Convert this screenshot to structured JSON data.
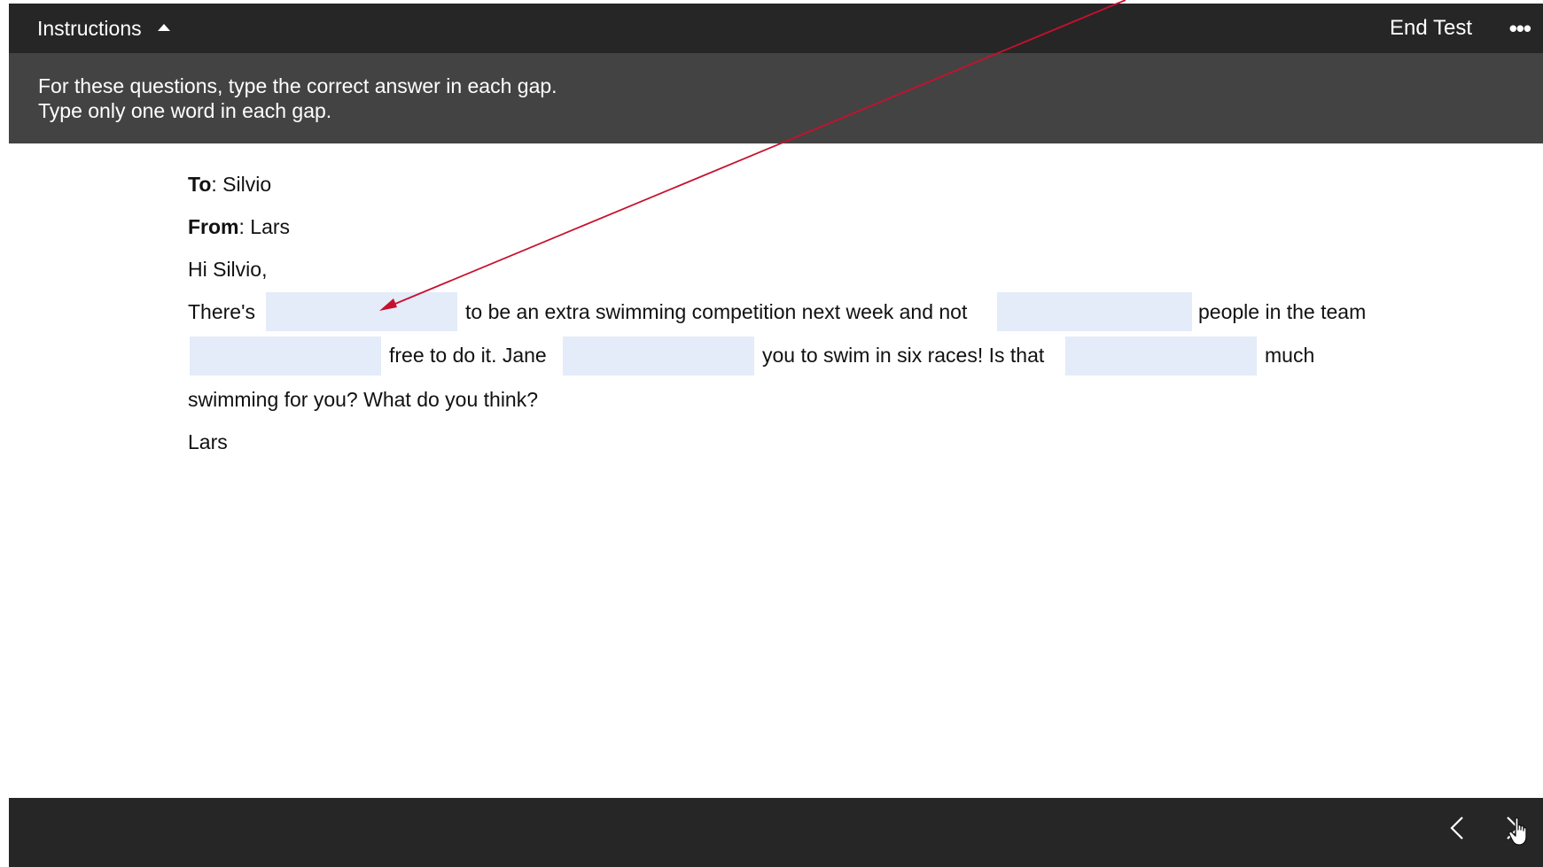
{
  "header": {
    "instructions_label": "Instructions",
    "end_test_label": "End Test",
    "more_label": "•••"
  },
  "instructions": {
    "line1": "For these questions, type the correct answer in each gap.",
    "line2": "Type only one word in each gap."
  },
  "email": {
    "to_label": "To",
    "to_value": ": Silvio",
    "from_label": "From",
    "from_value": ": Lars",
    "greeting": "Hi Silvio,",
    "line1": {
      "seg1": "There's",
      "seg2": "to be an extra swimming competition next week and not",
      "seg3": "people in the team"
    },
    "line2": {
      "seg1": "free to do it. Jane",
      "seg2": "you to swim in six races! Is that",
      "seg3": "much"
    },
    "line3": "swimming for you? What do you think?",
    "signoff": "Lars"
  },
  "gaps": [
    {
      "value": ""
    },
    {
      "value": ""
    },
    {
      "value": ""
    },
    {
      "value": ""
    },
    {
      "value": ""
    }
  ],
  "colors": {
    "header_bg": "#262626",
    "panel_bg": "#434343",
    "gap_fill": "#e3ecf8",
    "annotation_arrow": "#c8102e"
  },
  "icons": {
    "collapse": "caret-up-icon",
    "more": "ellipsis-icon",
    "prev": "chevron-left-icon",
    "next": "chevron-right-icon",
    "cursor": "hand-pointer-icon"
  }
}
